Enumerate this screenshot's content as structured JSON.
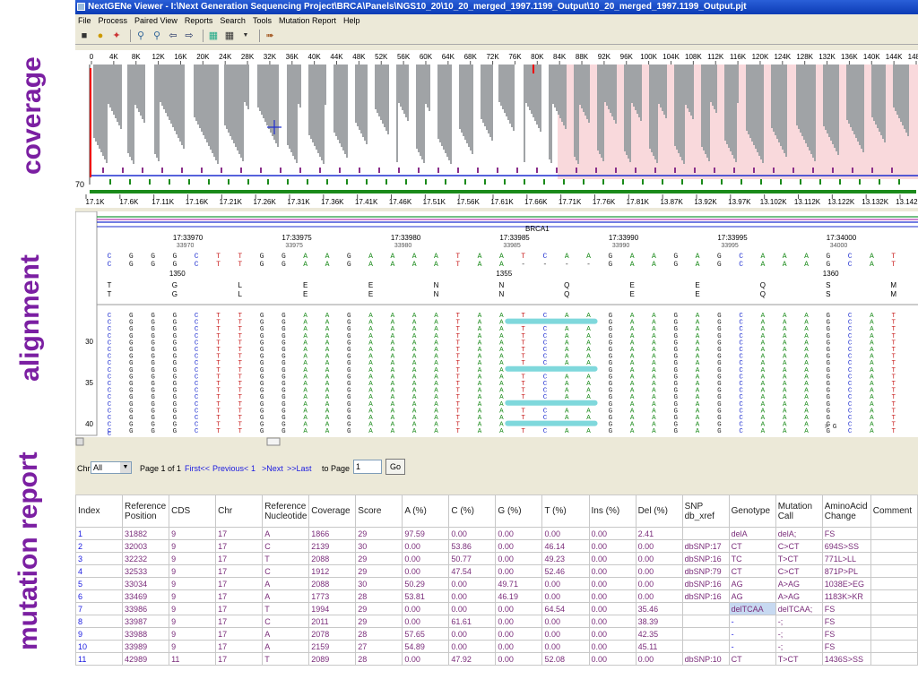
{
  "side_labels": {
    "coverage": "coverage",
    "alignment": "alignment",
    "report": "mutation report"
  },
  "window": {
    "title": "NextGENe Viewer - I:\\Next Generation Sequencing Project\\BRCA\\Panels\\NGS10_20\\10_20_merged_1997.1199_Output\\10_20_merged_1997.1199_Output.pjt"
  },
  "menu": [
    "File",
    "Process",
    "Paired View",
    "Reports",
    "Search",
    "Tools",
    "Mutation Report",
    "Help"
  ],
  "toolbar_icons": [
    "save-icon",
    "record-icon",
    "wand-icon",
    "zoom-in-icon",
    "zoom-out-icon",
    "back-arrow-icon",
    "forward-arrow-icon",
    "filter-icon",
    "grid-icon",
    "dropdown-icon",
    "export-icon"
  ],
  "coverage": {
    "top_ticks": [
      "0",
      "4K",
      "8K",
      "12K",
      "16K",
      "20K",
      "24K",
      "28K",
      "32K",
      "36K",
      "40K",
      "44K",
      "48K",
      "52K",
      "56K",
      "60K",
      "64K",
      "68K",
      "72K",
      "76K",
      "80K",
      "84K",
      "88K",
      "92K",
      "96K",
      "100K",
      "104K",
      "108K",
      "112K",
      "116K",
      "120K",
      "124K",
      "128K",
      "132K",
      "136K",
      "140K",
      "144K",
      "148K"
    ],
    "y_label": "70",
    "bottom_ticks": [
      "17.1K",
      "17.6K",
      "17.11K",
      "17.16K",
      "17.21K",
      "17.26K",
      "17.31K",
      "17.36K",
      "17.41K",
      "17.46K",
      "17.51K",
      "17.56K",
      "17.61K",
      "17.66K",
      "17.71K",
      "17.76K",
      "17.81K",
      "13.87K",
      "13.92K",
      "13.97K",
      "13.102K",
      "13.112K",
      "13.122K",
      "13.132K",
      "13.142K"
    ],
    "colors": {
      "bar": "#a0a3a6",
      "shade": "#f9d9dc",
      "baseline": "#1f2fd0",
      "track": "#1a8a1a"
    }
  },
  "alignment": {
    "gene": "BRCA1",
    "positions": [
      {
        "top": "17:33970",
        "sub": "33970"
      },
      {
        "top": "17:33975",
        "sub": "33975"
      },
      {
        "top": "17:33980",
        "sub": "33980"
      },
      {
        "top": "17:33985",
        "sub": "33985"
      },
      {
        "top": "17:33990",
        "sub": "33990"
      },
      {
        "top": "17:33995",
        "sub": "33995"
      },
      {
        "top": "17:34000",
        "sub": "34000"
      }
    ],
    "codon_labels": [
      "1350",
      "1355",
      "1360"
    ],
    "ref1": [
      "C",
      "G",
      "G",
      "G",
      "C",
      "T",
      "T",
      "G",
      "G",
      "A",
      "A",
      "G",
      "A",
      "A",
      "A",
      "A",
      "T",
      "A",
      "A",
      "T",
      "C",
      "A",
      "A",
      "G",
      "A",
      "A",
      "G",
      "A",
      "G",
      "C",
      "A",
      "A",
      "A",
      "G",
      "C",
      "A",
      "T"
    ],
    "ref2": [
      "C",
      "G",
      "G",
      "G",
      "C",
      "T",
      "T",
      "G",
      "G",
      "A",
      "A",
      "G",
      "A",
      "A",
      "A",
      "A",
      "T",
      "A",
      "A",
      "-",
      "-",
      "-",
      "-",
      "G",
      "A",
      "A",
      "G",
      "A",
      "G",
      "C",
      "A",
      "A",
      "A",
      "G",
      "C",
      "A",
      "T"
    ],
    "aa1": [
      "T",
      "",
      "",
      "G",
      "",
      "",
      "L",
      "",
      "",
      "E",
      "",
      "",
      "E",
      "",
      "",
      "N",
      "",
      "",
      "N",
      "",
      "",
      "Q",
      "",
      "",
      "E",
      "",
      "",
      "E",
      "",
      "",
      "Q",
      "",
      "",
      "S",
      "",
      "",
      "M"
    ],
    "aa2": [
      "T",
      "",
      "",
      "G",
      "",
      "",
      "L",
      "",
      "",
      "E",
      "",
      "",
      "E",
      "",
      "",
      "N",
      "",
      "",
      "N",
      "",
      "",
      "Q",
      "",
      "",
      "E",
      "",
      "",
      "E",
      "",
      "",
      "Q",
      "",
      "",
      "S",
      "",
      "",
      "M"
    ],
    "row_numbers": [
      "30",
      "35",
      "40"
    ],
    "last_read_tail": "> G",
    "bottom_char": "C"
  },
  "navbar": {
    "chr_label": "Chr",
    "chr_value": "All",
    "page_info": "Page 1 of 1",
    "first": "First<<",
    "previous": "Previous<",
    "page_num": "1",
    "next": ">Next",
    "last": ">>Last",
    "to_page": "to Page",
    "to_page_value": "1",
    "go": "Go"
  },
  "table": {
    "headers": [
      "Index",
      "Reference Position",
      "CDS",
      "Chr",
      "Reference Nucleotide",
      "Coverage",
      "Score",
      "A (%)",
      "C (%)",
      "G (%)",
      "T (%)",
      "Ins (%)",
      "Del (%)",
      "SNP db_xref",
      "Genotype",
      "Mutation Call",
      "AminoAcid Change",
      "Comment"
    ],
    "rows": [
      [
        "1",
        "31882",
        "9",
        "17",
        "A",
        "1866",
        "29",
        "97.59",
        "0.00",
        "0.00",
        "0.00",
        "0.00",
        "2.41",
        "",
        "delA",
        "delA;",
        "FS",
        ""
      ],
      [
        "2",
        "32003",
        "9",
        "17",
        "C",
        "2139",
        "30",
        "0.00",
        "53.86",
        "0.00",
        "46.14",
        "0.00",
        "0.00",
        "dbSNP:17",
        "CT",
        "C>CT",
        "694S>SS",
        ""
      ],
      [
        "3",
        "32232",
        "9",
        "17",
        "T",
        "2088",
        "29",
        "0.00",
        "50.77",
        "0.00",
        "49.23",
        "0.00",
        "0.00",
        "dbSNP:16",
        "TC",
        "T>CT",
        "771L>LL",
        ""
      ],
      [
        "4",
        "32533",
        "9",
        "17",
        "C",
        "1912",
        "29",
        "0.00",
        "47.54",
        "0.00",
        "52.46",
        "0.00",
        "0.00",
        "dbSNP:79",
        "CT",
        "C>CT",
        "871P>PL",
        ""
      ],
      [
        "5",
        "33034",
        "9",
        "17",
        "A",
        "2088",
        "30",
        "50.29",
        "0.00",
        "49.71",
        "0.00",
        "0.00",
        "0.00",
        "dbSNP:16",
        "AG",
        "A>AG",
        "1038E>EG",
        ""
      ],
      [
        "6",
        "33469",
        "9",
        "17",
        "A",
        "1773",
        "28",
        "53.81",
        "0.00",
        "46.19",
        "0.00",
        "0.00",
        "0.00",
        "dbSNP:16",
        "AG",
        "A>AG",
        "1183K>KR",
        ""
      ],
      [
        "7",
        "33986",
        "9",
        "17",
        "T",
        "1994",
        "29",
        "0.00",
        "0.00",
        "0.00",
        "64.54",
        "0.00",
        "35.46",
        "",
        "delTCAA",
        "delTCAA;",
        "FS",
        ""
      ],
      [
        "8",
        "33987",
        "9",
        "17",
        "C",
        "2011",
        "29",
        "0.00",
        "61.61",
        "0.00",
        "0.00",
        "0.00",
        "38.39",
        "",
        "-",
        "-;",
        "FS",
        ""
      ],
      [
        "9",
        "33988",
        "9",
        "17",
        "A",
        "2078",
        "28",
        "57.65",
        "0.00",
        "0.00",
        "0.00",
        "0.00",
        "42.35",
        "",
        "-",
        "-;",
        "FS",
        ""
      ],
      [
        "10",
        "33989",
        "9",
        "17",
        "A",
        "2159",
        "27",
        "54.89",
        "0.00",
        "0.00",
        "0.00",
        "0.00",
        "45.11",
        "",
        "-",
        "-;",
        "FS",
        ""
      ],
      [
        "11",
        "42989",
        "11",
        "17",
        "T",
        "2089",
        "28",
        "0.00",
        "47.92",
        "0.00",
        "52.08",
        "0.00",
        "0.00",
        "dbSNP:10",
        "CT",
        "T>CT",
        "1436S>SS",
        ""
      ]
    ]
  }
}
